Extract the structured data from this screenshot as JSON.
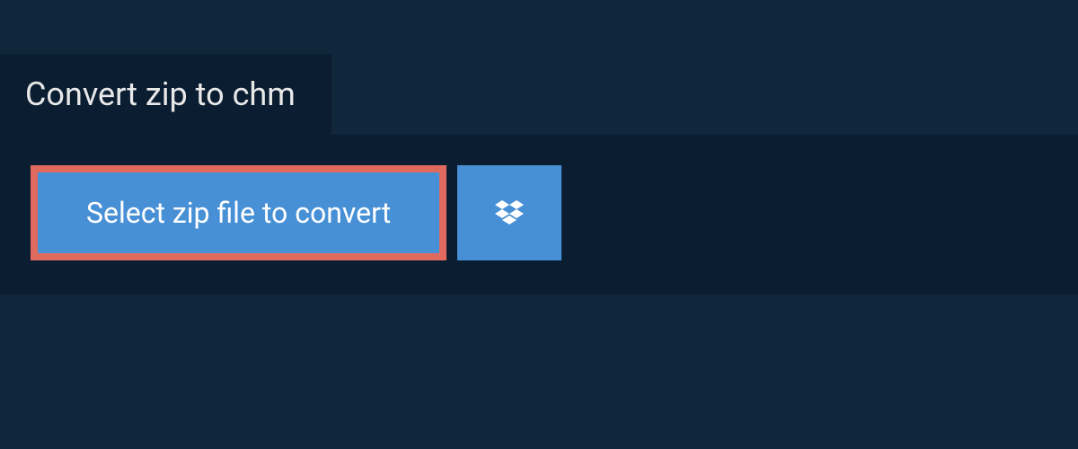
{
  "header": {
    "title": "Convert zip to chm"
  },
  "upload": {
    "select_label": "Select zip file to convert"
  },
  "colors": {
    "bg_outer": "#10263b",
    "bg_panel": "#0b1d30",
    "button_bg": "#4790d6",
    "highlight_border": "#e16a5e",
    "text_light": "#e8e8e8",
    "text_white": "#ffffff"
  }
}
